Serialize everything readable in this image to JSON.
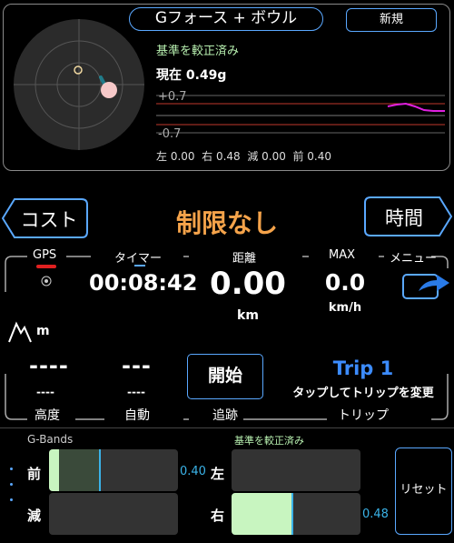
{
  "header": {
    "title": "Gフォース + ボウル",
    "new_button": "新規"
  },
  "gforce": {
    "calibration": "基準を較正済み",
    "current": "現在 0.49g",
    "axis_upper": "+0.7",
    "axis_lower": "-0.7",
    "readout": "左 0.00  右 0.48  減 0.00  前 0.40"
  },
  "controls": {
    "cost_button": "コスト",
    "time_button": "時間",
    "limit_text": "制限なし"
  },
  "stats": {
    "gps_label": "GPS",
    "timer_label": "タイマー",
    "distance_label": "距離",
    "max_label": "MAX",
    "menu_label": "メニュー",
    "timer_value": "00:08:42",
    "distance_value": "0.00",
    "distance_unit": "km",
    "max_value": "0.0",
    "max_unit": "km/h",
    "altitude_unit": "m",
    "altitude_value": "----",
    "altitude_sub": "----",
    "auto_value": "---",
    "auto_sub": "----",
    "start_button": "開始",
    "trip_name": "Trip 1",
    "trip_hint": "タップしてトリップを変更",
    "altitude_label": "高度",
    "auto_label": "自動",
    "track_label": "追跡",
    "trip_label": "トリップ"
  },
  "gbands": {
    "title": "G-Bands",
    "calibration": "基準を較正済み",
    "front_label": "前",
    "brake_label": "減",
    "left_label": "左",
    "right_label": "右",
    "front_value": "0.40",
    "right_value": "0.48",
    "front_fraction": 0.4,
    "right_fraction": 0.48,
    "reset_button": "リセット"
  },
  "colors": {
    "accent": "#5aa8ff",
    "limit": "#f5a34a",
    "calibration": "#b8f0b0",
    "trip": "#3c8cff",
    "bar_fill": "#c8f5c0",
    "bar_value": "#3ab3e8",
    "gps_status": "#e02020"
  }
}
